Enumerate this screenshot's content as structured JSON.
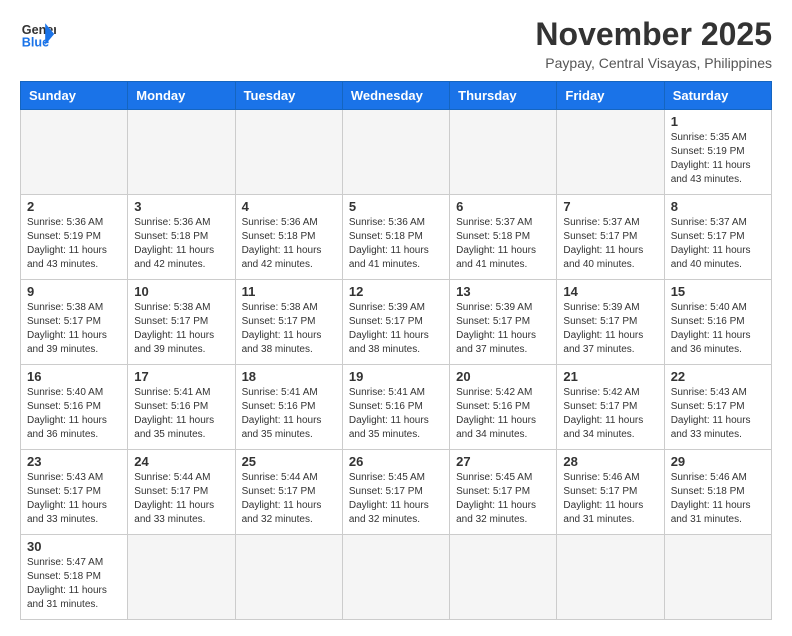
{
  "header": {
    "logo_general": "General",
    "logo_blue": "Blue",
    "month": "November 2025",
    "location": "Paypay, Central Visayas, Philippines"
  },
  "weekdays": [
    "Sunday",
    "Monday",
    "Tuesday",
    "Wednesday",
    "Thursday",
    "Friday",
    "Saturday"
  ],
  "days": [
    {
      "date": "",
      "info": ""
    },
    {
      "date": "",
      "info": ""
    },
    {
      "date": "",
      "info": ""
    },
    {
      "date": "",
      "info": ""
    },
    {
      "date": "",
      "info": ""
    },
    {
      "date": "",
      "info": ""
    },
    {
      "date": "1",
      "sunrise": "5:35 AM",
      "sunset": "5:19 PM",
      "daylight": "11 hours and 43 minutes."
    },
    {
      "date": "2",
      "sunrise": "5:36 AM",
      "sunset": "5:19 PM",
      "daylight": "11 hours and 43 minutes."
    },
    {
      "date": "3",
      "sunrise": "5:36 AM",
      "sunset": "5:18 PM",
      "daylight": "11 hours and 42 minutes."
    },
    {
      "date": "4",
      "sunrise": "5:36 AM",
      "sunset": "5:18 PM",
      "daylight": "11 hours and 42 minutes."
    },
    {
      "date": "5",
      "sunrise": "5:36 AM",
      "sunset": "5:18 PM",
      "daylight": "11 hours and 41 minutes."
    },
    {
      "date": "6",
      "sunrise": "5:37 AM",
      "sunset": "5:18 PM",
      "daylight": "11 hours and 41 minutes."
    },
    {
      "date": "7",
      "sunrise": "5:37 AM",
      "sunset": "5:17 PM",
      "daylight": "11 hours and 40 minutes."
    },
    {
      "date": "8",
      "sunrise": "5:37 AM",
      "sunset": "5:17 PM",
      "daylight": "11 hours and 40 minutes."
    },
    {
      "date": "9",
      "sunrise": "5:38 AM",
      "sunset": "5:17 PM",
      "daylight": "11 hours and 39 minutes."
    },
    {
      "date": "10",
      "sunrise": "5:38 AM",
      "sunset": "5:17 PM",
      "daylight": "11 hours and 39 minutes."
    },
    {
      "date": "11",
      "sunrise": "5:38 AM",
      "sunset": "5:17 PM",
      "daylight": "11 hours and 38 minutes."
    },
    {
      "date": "12",
      "sunrise": "5:39 AM",
      "sunset": "5:17 PM",
      "daylight": "11 hours and 38 minutes."
    },
    {
      "date": "13",
      "sunrise": "5:39 AM",
      "sunset": "5:17 PM",
      "daylight": "11 hours and 37 minutes."
    },
    {
      "date": "14",
      "sunrise": "5:39 AM",
      "sunset": "5:17 PM",
      "daylight": "11 hours and 37 minutes."
    },
    {
      "date": "15",
      "sunrise": "5:40 AM",
      "sunset": "5:16 PM",
      "daylight": "11 hours and 36 minutes."
    },
    {
      "date": "16",
      "sunrise": "5:40 AM",
      "sunset": "5:16 PM",
      "daylight": "11 hours and 36 minutes."
    },
    {
      "date": "17",
      "sunrise": "5:41 AM",
      "sunset": "5:16 PM",
      "daylight": "11 hours and 35 minutes."
    },
    {
      "date": "18",
      "sunrise": "5:41 AM",
      "sunset": "5:16 PM",
      "daylight": "11 hours and 35 minutes."
    },
    {
      "date": "19",
      "sunrise": "5:41 AM",
      "sunset": "5:16 PM",
      "daylight": "11 hours and 35 minutes."
    },
    {
      "date": "20",
      "sunrise": "5:42 AM",
      "sunset": "5:16 PM",
      "daylight": "11 hours and 34 minutes."
    },
    {
      "date": "21",
      "sunrise": "5:42 AM",
      "sunset": "5:17 PM",
      "daylight": "11 hours and 34 minutes."
    },
    {
      "date": "22",
      "sunrise": "5:43 AM",
      "sunset": "5:17 PM",
      "daylight": "11 hours and 33 minutes."
    },
    {
      "date": "23",
      "sunrise": "5:43 AM",
      "sunset": "5:17 PM",
      "daylight": "11 hours and 33 minutes."
    },
    {
      "date": "24",
      "sunrise": "5:44 AM",
      "sunset": "5:17 PM",
      "daylight": "11 hours and 33 minutes."
    },
    {
      "date": "25",
      "sunrise": "5:44 AM",
      "sunset": "5:17 PM",
      "daylight": "11 hours and 32 minutes."
    },
    {
      "date": "26",
      "sunrise": "5:45 AM",
      "sunset": "5:17 PM",
      "daylight": "11 hours and 32 minutes."
    },
    {
      "date": "27",
      "sunrise": "5:45 AM",
      "sunset": "5:17 PM",
      "daylight": "11 hours and 32 minutes."
    },
    {
      "date": "28",
      "sunrise": "5:46 AM",
      "sunset": "5:17 PM",
      "daylight": "11 hours and 31 minutes."
    },
    {
      "date": "29",
      "sunrise": "5:46 AM",
      "sunset": "5:18 PM",
      "daylight": "11 hours and 31 minutes."
    },
    {
      "date": "30",
      "sunrise": "5:47 AM",
      "sunset": "5:18 PM",
      "daylight": "11 hours and 31 minutes."
    }
  ],
  "labels": {
    "sunrise_prefix": "Sunrise: ",
    "sunset_prefix": "Sunset: ",
    "daylight_prefix": "Daylight: "
  }
}
